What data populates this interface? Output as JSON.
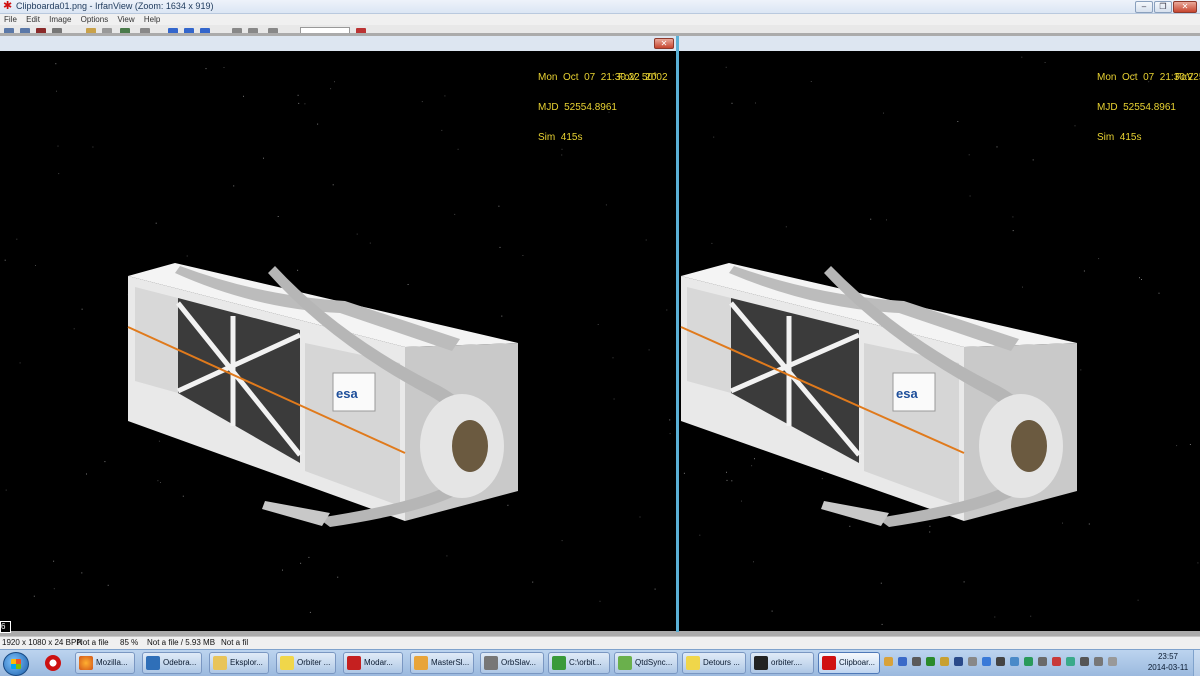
{
  "window": {
    "title": "Clipboarda01.png - IrfanView (Zoom: 1634 x 919)",
    "min_glyph": "–",
    "max_glyph": "❐",
    "close_glyph": "✕"
  },
  "menu": [
    "File",
    "Edit",
    "Image",
    "Options",
    "View",
    "Help"
  ],
  "hud_left": {
    "line1": "Mon  Oct  07  21:30:22  2002",
    "line2": "MJD  52554.8961",
    "line3": "Sim  415s",
    "fov": "FoV  50°"
  },
  "hud_right": {
    "line1": "Mon  Oct  07  21:30:22  200",
    "line2": "MJD  52554.8961",
    "line3": "Sim  415s",
    "fov": "FoV  5"
  },
  "module_logo": "esa",
  "corner_mark": "6",
  "status": {
    "dims": "1920 x 1080 x 24 BPP",
    "file": "Not a file",
    "zoom": "85 %",
    "size": "Not a file / 5.93 MB",
    "file2": "Not a fil"
  },
  "taskbar": {
    "tasks": [
      "Mozilla...",
      "Odebra...",
      "Eksplor...",
      "Orbiter ...",
      "Modar...",
      "MasterSl...",
      "OrbSlav...",
      "C:\\orbit...",
      "QtdSync...",
      "Detours ...",
      "orbiter....",
      "Clipboar..."
    ],
    "clock_time": "23:57",
    "clock_date": "2014-03-11"
  },
  "colors": {
    "hud_text": "#e8d232",
    "divider": "#5ab0d6",
    "orange_rail": "#e07a1c"
  }
}
